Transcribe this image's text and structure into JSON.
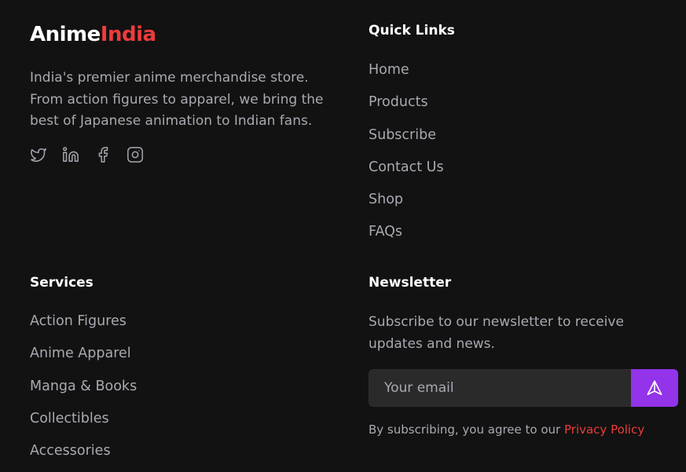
{
  "brand": {
    "name_part1": "Anime",
    "name_part2": "India",
    "accent_color": "#ef3b3b"
  },
  "description": "India's premier anime merchandise store. From action figures to apparel, we bring the best of Japanese animation to Indian fans.",
  "social": [
    "twitter-icon",
    "linkedin-icon",
    "facebook-icon",
    "instagram-icon"
  ],
  "quick_links": {
    "title": "Quick Links",
    "items": [
      "Home",
      "Products",
      "Subscribe",
      "Contact Us",
      "Shop",
      "FAQs"
    ]
  },
  "services": {
    "title": "Services",
    "items": [
      "Action Figures",
      "Anime Apparel",
      "Manga & Books",
      "Collectibles",
      "Accessories"
    ]
  },
  "newsletter": {
    "title": "Newsletter",
    "text": "Subscribe to our newsletter to receive updates and news.",
    "placeholder": "Your email",
    "button_icon": "send-icon",
    "button_color": "#9333ea",
    "consent_prefix": "By subscribing, you agree to our",
    "consent_link": "Privacy Policy"
  }
}
